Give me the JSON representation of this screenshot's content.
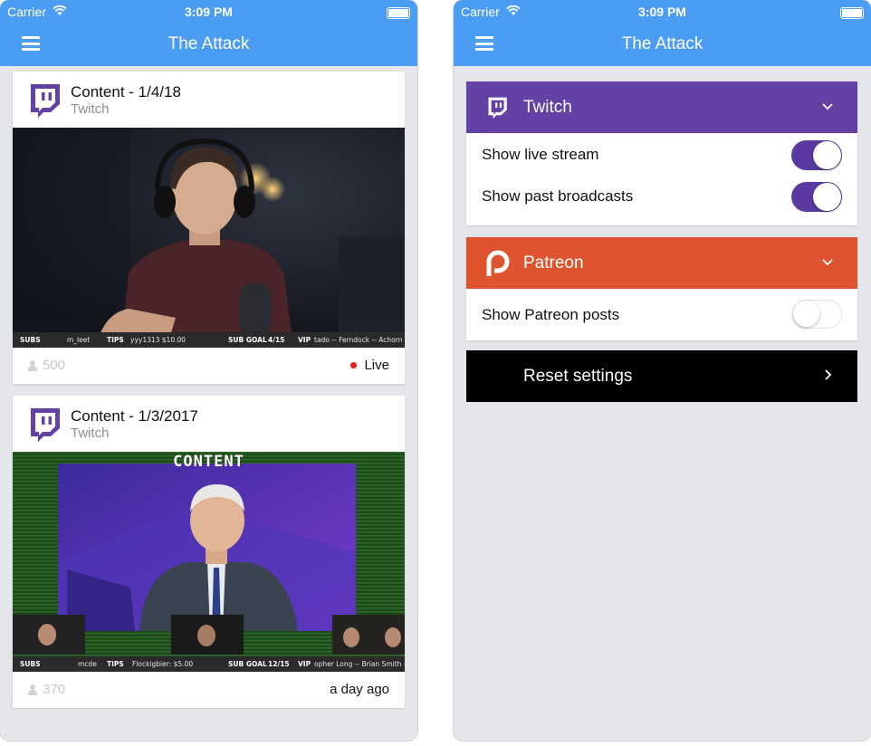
{
  "status_bar": {
    "carrier": "Carrier",
    "time": "3:09 PM"
  },
  "app": {
    "title": "The Attack"
  },
  "feed": {
    "items": [
      {
        "title": "Content - 1/4/18",
        "source": "Twitch",
        "viewers": "500",
        "status": "Live",
        "ticker": {
          "subs_key": "SUBS",
          "subs_val": "m_leet",
          "tips_key": "TIPS",
          "tips_val": "yyy1313 $10.00",
          "goal_key": "SUB GOAL",
          "goal_val": "4/15",
          "vip_key": "VIP",
          "vip_val": "tado -- Ferndock -- Achorn"
        }
      },
      {
        "title": "Content - 1/3/2017",
        "source": "Twitch",
        "viewers": "370",
        "status": "a day ago",
        "banner": "CONTENT",
        "ticker": {
          "subs_key": "SUBS",
          "subs_val": "mcde",
          "tips_key": "TIPS",
          "tips_val": "Flockigbier: $5.00",
          "goal_key": "SUB GOAL",
          "goal_val": "12/15",
          "vip_key": "VIP",
          "vip_val": "opher Long -- Brian Smith --"
        }
      }
    ]
  },
  "settings": {
    "twitch": {
      "label": "Twitch",
      "color": "#6441a4",
      "rows": [
        {
          "label": "Show live stream",
          "enabled": true
        },
        {
          "label": "Show past broadcasts",
          "enabled": true
        }
      ]
    },
    "patreon": {
      "label": "Patreon",
      "color": "#e0532f",
      "rows": [
        {
          "label": "Show Patreon posts",
          "enabled": false
        }
      ]
    },
    "reset": {
      "label": "Reset settings"
    }
  },
  "icons": {
    "menu": "menu-icon",
    "twitch": "twitch-icon",
    "patreon": "patreon-icon",
    "chevron_down": "chevron-down-icon",
    "chevron_right": "chevron-right-icon",
    "wifi": "wifi-icon",
    "battery": "battery-icon",
    "viewers": "person-icon",
    "live": "live-dot-icon"
  },
  "colors": {
    "nav": "#4b9cf3",
    "background": "#e5e6ec",
    "twitch": "#6441a4",
    "patreon": "#e0532f",
    "toggle_on": "#5a3aa0"
  }
}
